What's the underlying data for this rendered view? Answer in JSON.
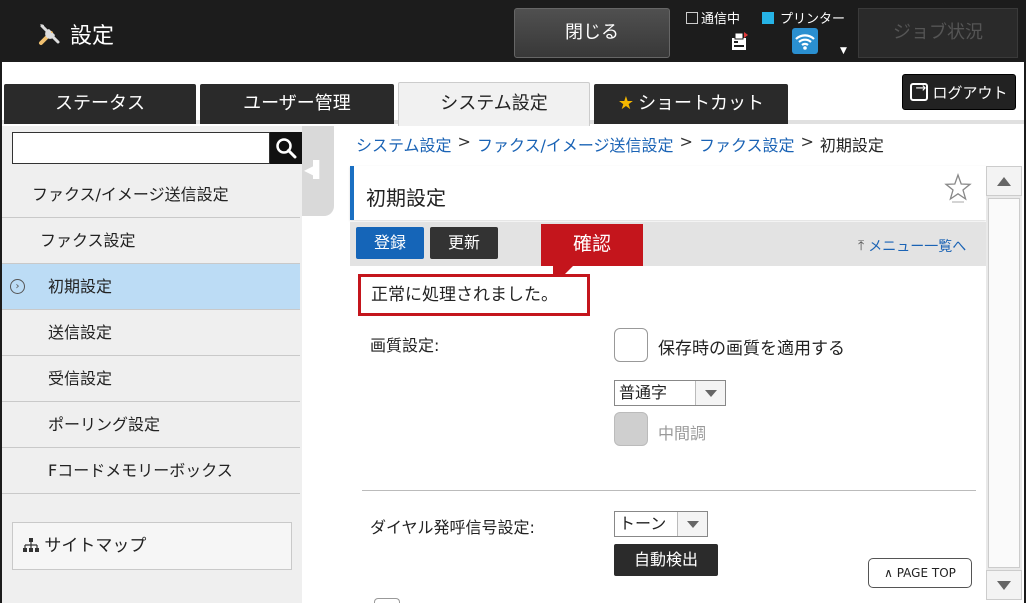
{
  "topbar": {
    "title": "設定",
    "close_label": "閉じる",
    "comm_label": "通信中",
    "printer_label": "プリンター",
    "job_status_label": "ジョブ状況"
  },
  "tabs": [
    {
      "label": "ステータス",
      "active": false
    },
    {
      "label": "ユーザー管理",
      "active": false
    },
    {
      "label": "システム設定",
      "active": true
    },
    {
      "label": "ショートカット",
      "active": false
    }
  ],
  "logout_label": "ログアウト",
  "search": {
    "value": "",
    "placeholder": ""
  },
  "sidebar": {
    "items": [
      {
        "label": "ファクス/イメージ送信設定",
        "level": 1,
        "active": false
      },
      {
        "label": "ファクス設定",
        "level": 2,
        "active": false
      },
      {
        "label": "初期設定",
        "level": 3,
        "active": true
      },
      {
        "label": "送信設定",
        "level": 3,
        "active": false
      },
      {
        "label": "受信設定",
        "level": 3,
        "active": false
      },
      {
        "label": "ポーリング設定",
        "level": 3,
        "active": false
      },
      {
        "label": "Fコードメモリーボックス",
        "level": 3,
        "active": false
      }
    ],
    "sitemap_label": "サイトマップ"
  },
  "breadcrumb": {
    "items": [
      "システム設定",
      "ファクス/イメージ送信設定",
      "ファクス設定"
    ],
    "separator": ">",
    "current": "初期設定"
  },
  "page": {
    "title": "初期設定",
    "register_label": "登録",
    "update_label": "更新",
    "confirm_label": "確認",
    "menu_link_label": "メニュー一覧へ",
    "message": "正常に処理されました。"
  },
  "form": {
    "image_quality": {
      "label": "画質設定:",
      "apply_saved_label": "保存時の画質を適用する",
      "apply_saved_checked": false,
      "quality_select": "普通字",
      "halftone_label": "中間調",
      "halftone_checked": false,
      "halftone_disabled": true
    },
    "dial": {
      "label": "ダイヤル発呼信号設定:",
      "select_value": "トーン",
      "auto_detect_label": "自動検出"
    }
  },
  "page_top_label": "PAGE TOP",
  "colors": {
    "accent_blue": "#1565b8",
    "link_blue": "#1a63b5",
    "confirm_red": "#c4151c",
    "active_nav": "#bcdcf5",
    "star_yellow": "#f5b800"
  }
}
